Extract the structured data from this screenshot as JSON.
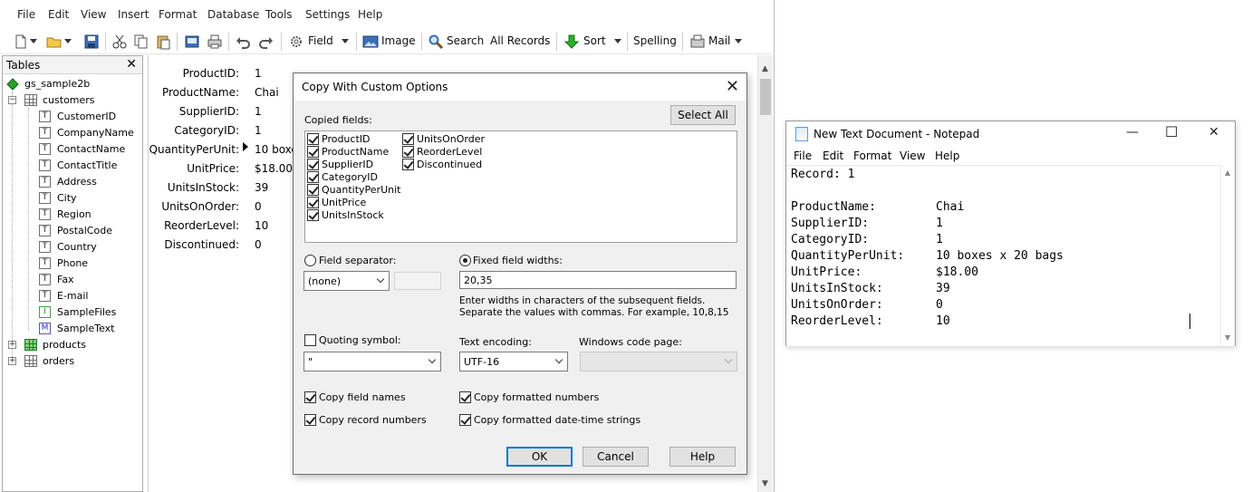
{
  "app": {
    "menu": [
      "File",
      "Edit",
      "View",
      "Insert",
      "Format",
      "Database",
      "Tools",
      "Settings",
      "Help"
    ],
    "toolbar": {
      "field_label": "Field",
      "image_label": "Image",
      "search_label": "Search",
      "all_records_label": "All Records",
      "sort_label": "Sort",
      "spelling_label": "Spelling",
      "mail_label": "Mail"
    },
    "tables_panel": {
      "title": "Tables",
      "close": "✕",
      "database": "gs_sample2b",
      "customers": "customers",
      "customer_fields": [
        {
          "type": "T",
          "name": "CustomerID"
        },
        {
          "type": "T",
          "name": "CompanyName"
        },
        {
          "type": "T",
          "name": "ContactName"
        },
        {
          "type": "T",
          "name": "ContactTitle"
        },
        {
          "type": "T",
          "name": "Address"
        },
        {
          "type": "T",
          "name": "City"
        },
        {
          "type": "T",
          "name": "Region"
        },
        {
          "type": "T",
          "name": "PostalCode"
        },
        {
          "type": "T",
          "name": "Country"
        },
        {
          "type": "T",
          "name": "Phone"
        },
        {
          "type": "T",
          "name": "Fax"
        },
        {
          "type": "T",
          "name": "E-mail"
        },
        {
          "type": "I",
          "name": "SampleFiles"
        },
        {
          "type": "M",
          "name": "SampleText"
        }
      ],
      "products": "products",
      "orders": "orders"
    },
    "record": [
      {
        "label": "ProductID:",
        "value": "1"
      },
      {
        "label": "ProductName:",
        "value": "Chai"
      },
      {
        "label": "SupplierID:",
        "value": "1"
      },
      {
        "label": "CategoryID:",
        "value": "1"
      },
      {
        "label": "QuantityPerUnit:",
        "value": "10 boxe"
      },
      {
        "label": "UnitPrice:",
        "value": "$18.00"
      },
      {
        "label": "UnitsInStock:",
        "value": "39"
      },
      {
        "label": "UnitsOnOrder:",
        "value": "0"
      },
      {
        "label": "ReorderLevel:",
        "value": "10"
      },
      {
        "label": "Discontinued:",
        "value": "0"
      }
    ]
  },
  "dialog": {
    "title": "Copy With Custom Options",
    "copied_fields_label": "Copied fields:",
    "select_all": "Select All",
    "fields_col1": [
      "ProductID",
      "ProductName",
      "SupplierID",
      "CategoryID",
      "QuantityPerUnit",
      "UnitPrice",
      "UnitsInStock"
    ],
    "fields_col2": [
      "UnitsOnOrder",
      "ReorderLevel",
      "Discontinued"
    ],
    "field_separator_label": "Field separator:",
    "field_separator_value": "(none)",
    "fixed_widths_label": "Fixed field widths:",
    "fixed_widths_value": "20,35",
    "widths_help_1": "Enter widths in characters of the subsequent fields.",
    "widths_help_2": "Separate the values with commas. For example, 10,8,15",
    "quoting_label": "Quoting symbol:",
    "quoting_value": "\"",
    "encoding_label": "Text encoding:",
    "encoding_value": "UTF-16",
    "codepage_label": "Windows code page:",
    "copy_field_names": "Copy field names",
    "copy_record_numbers": "Copy record numbers",
    "copy_formatted_numbers": "Copy formatted numbers",
    "copy_formatted_dates": "Copy formatted date-time strings",
    "ok": "OK",
    "cancel": "Cancel",
    "help": "Help"
  },
  "notepad": {
    "title": "New Text Document - Notepad",
    "minimize": "—",
    "maximize": "☐",
    "close": "✕",
    "menu": [
      "File",
      "Edit",
      "Format",
      "View",
      "Help"
    ],
    "record_line": "Record: 1",
    "lines": [
      {
        "label": "ProductName:",
        "value": "Chai"
      },
      {
        "label": "SupplierID:",
        "value": "1"
      },
      {
        "label": "CategoryID:",
        "value": "1"
      },
      {
        "label": "QuantityPerUnit:",
        "value": "10 boxes x 20 bags"
      },
      {
        "label": "UnitPrice:",
        "value": "$18.00"
      },
      {
        "label": "UnitsInStock:",
        "value": "39"
      },
      {
        "label": "UnitsOnOrder:",
        "value": "0"
      },
      {
        "label": "ReorderLevel:",
        "value": "10"
      }
    ]
  }
}
